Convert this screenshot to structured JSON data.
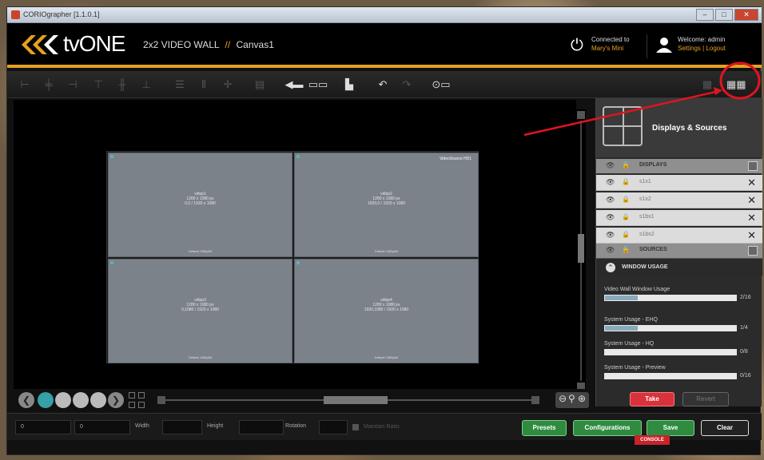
{
  "window": {
    "title": "CORIOgrapher [1.1.0.1]"
  },
  "header": {
    "logo_text": "tvONE",
    "project_name": "2x2 VIDEO WALL",
    "project_sep": "//",
    "canvas_name": "Canvas1",
    "connection": {
      "line1": "Connected to",
      "line2": "Mary's Mini"
    },
    "user": {
      "line1": "Welcome: admin",
      "line2": "Settings | Logout"
    }
  },
  "canvas": {
    "cells": [
      {
        "title": "vdisp1",
        "lines": [
          "1280 x 1080 px",
          "0,0 / 1920 x 1080"
        ],
        "footer": "Default 1080p60"
      },
      {
        "title": "vdisp2",
        "lines": [
          "1280 x 1080 px",
          "1920,0 / 1920 x 1080"
        ],
        "footer": "Default 1080p60",
        "corner": "VideoSource HD1"
      },
      {
        "title": "vdisp3",
        "lines": [
          "1280 x 1080 px",
          "0,1080 / 1920 x 1080"
        ],
        "footer": "Default 1080p60"
      },
      {
        "title": "vdisp4",
        "lines": [
          "1280 x 1080 px",
          "1920,1080 / 1920 x 1080"
        ],
        "footer": "Default 1080p60"
      }
    ]
  },
  "panel": {
    "title": "Displays & Sources",
    "displays_label": "DISPLAYS",
    "displays": [
      {
        "name": "s1x1"
      },
      {
        "name": "s1x2"
      },
      {
        "name": "s1bx1"
      },
      {
        "name": "s1bx2"
      }
    ],
    "sources_label": "SOURCES",
    "window_usage_label": "WINDOW USAGE",
    "usage": [
      {
        "label": "Video Wall Window Usage",
        "value": "2/16",
        "fraction": 0.25
      },
      {
        "label": "System Usage - EHQ",
        "value": "1/4",
        "fraction": 0.25
      },
      {
        "label": "System Usage - HQ",
        "value": "0/8",
        "fraction": 0
      },
      {
        "label": "System Usage - Preview",
        "value": "0/16",
        "fraction": 0
      }
    ],
    "take_label": "Take",
    "revert_label": "Revert"
  },
  "status": {
    "x_value": "0",
    "y_value": "0",
    "width_label": "Width",
    "height_label": "Height",
    "rotation_label": "Rotation",
    "maintain_ratio_label": "Maintain Ratio",
    "presets_label": "Presets",
    "configurations_label": "Configurations",
    "save_label": "Save",
    "clear_label": "Clear",
    "console_label": "CONSOLE"
  },
  "colors": {
    "accent": "#e6a020",
    "take": "#d8323c",
    "action_green": "#2e8b3f",
    "annotation_red": "#e0141e"
  }
}
